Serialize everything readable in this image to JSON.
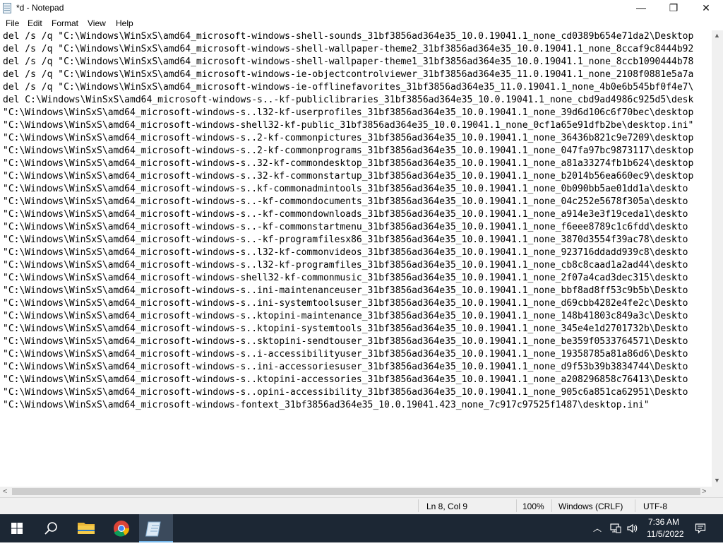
{
  "window": {
    "title": "*d - Notepad"
  },
  "controls": {
    "minimize": "—",
    "maximize": "❐",
    "close": "✕"
  },
  "menu": [
    "File",
    "Edit",
    "Format",
    "View",
    "Help"
  ],
  "editor": {
    "lines": [
      "del /s /q \"C:\\Windows\\WinSxS\\amd64_microsoft-windows-shell-sounds_31bf3856ad364e35_10.0.19041.1_none_cd0389b654e71da2\\Desktop",
      "del /s /q \"C:\\Windows\\WinSxS\\amd64_microsoft-windows-shell-wallpaper-theme2_31bf3856ad364e35_10.0.19041.1_none_8ccaf9c8444b92",
      "del /s /q \"C:\\Windows\\WinSxS\\amd64_microsoft-windows-shell-wallpaper-theme1_31bf3856ad364e35_10.0.19041.1_none_8ccb1090444b78",
      "del /s /q \"C:\\Windows\\WinSxS\\amd64_microsoft-windows-ie-objectcontrolviewer_31bf3856ad364e35_11.0.19041.1_none_2108f0881e5a7a",
      "del /s /q \"C:\\Windows\\WinSxS\\amd64_microsoft-windows-ie-offlinefavorites_31bf3856ad364e35_11.0.19041.1_none_4b0e6b545bf0f4e7\\",
      "del C:\\Windows\\WinSxS\\amd64_microsoft-windows-s..-kf-publiclibraries_31bf3856ad364e35_10.0.19041.1_none_cbd9ad4986c925d5\\desk",
      "\"C:\\Windows\\WinSxS\\amd64_microsoft-windows-s..l32-kf-userprofiles_31bf3856ad364e35_10.0.19041.1_none_39d6d106c6f70bec\\desktop",
      "\"C:\\Windows\\WinSxS\\amd64_microsoft-windows-shell32-kf-public_31bf3856ad364e35_10.0.19041.1_none_0cf1a65e91dfb2be\\desktop.ini\"",
      "\"C:\\Windows\\WinSxS\\amd64_microsoft-windows-s..2-kf-commonpictures_31bf3856ad364e35_10.0.19041.1_none_36436b821c9e7209\\desktop",
      "\"C:\\Windows\\WinSxS\\amd64_microsoft-windows-s..2-kf-commonprograms_31bf3856ad364e35_10.0.19041.1_none_047fa97bc9873117\\desktop",
      "\"C:\\Windows\\WinSxS\\amd64_microsoft-windows-s..32-kf-commondesktop_31bf3856ad364e35_10.0.19041.1_none_a81a33274fb1b624\\desktop",
      "\"C:\\Windows\\WinSxS\\amd64_microsoft-windows-s..32-kf-commonstartup_31bf3856ad364e35_10.0.19041.1_none_b2014b56ea660ec9\\desktop",
      "\"C:\\Windows\\WinSxS\\amd64_microsoft-windows-s..kf-commonadmintools_31bf3856ad364e35_10.0.19041.1_none_0b090bb5ae01dd1a\\deskto",
      "\"C:\\Windows\\WinSxS\\amd64_microsoft-windows-s..-kf-commondocuments_31bf3856ad364e35_10.0.19041.1_none_04c252e5678f305a\\deskto",
      "\"C:\\Windows\\WinSxS\\amd64_microsoft-windows-s..-kf-commondownloads_31bf3856ad364e35_10.0.19041.1_none_a914e3e3f19ceda1\\deskto",
      "\"C:\\Windows\\WinSxS\\amd64_microsoft-windows-s..-kf-commonstartmenu_31bf3856ad364e35_10.0.19041.1_none_f6eee8789c1c6fdd\\deskto",
      "\"C:\\Windows\\WinSxS\\amd64_microsoft-windows-s..-kf-programfilesx86_31bf3856ad364e35_10.0.19041.1_none_3870d3554f39ac78\\deskto",
      "\"C:\\Windows\\WinSxS\\amd64_microsoft-windows-s..l32-kf-commonvideos_31bf3856ad364e35_10.0.19041.1_none_923716ddadd939c8\\deskto",
      "\"C:\\Windows\\WinSxS\\amd64_microsoft-windows-s..l32-kf-programfiles_31bf3856ad364e35_10.0.19041.1_none_cb8c8caad1a2ad44\\deskto",
      "\"C:\\Windows\\WinSxS\\amd64_microsoft-windows-shell32-kf-commonmusic_31bf3856ad364e35_10.0.19041.1_none_2f07a4cad3dec315\\deskto",
      "\"C:\\Windows\\WinSxS\\amd64_microsoft-windows-s..ini-maintenanceuser_31bf3856ad364e35_10.0.19041.1_none_bbf8ad8ff53c9b5b\\Deskto",
      "\"C:\\Windows\\WinSxS\\amd64_microsoft-windows-s..ini-systemtoolsuser_31bf3856ad364e35_10.0.19041.1_none_d69cbb4282e4fe2c\\Deskto",
      "\"C:\\Windows\\WinSxS\\amd64_microsoft-windows-s..ktopini-maintenance_31bf3856ad364e35_10.0.19041.1_none_148b41803c849a3c\\Deskto",
      "\"C:\\Windows\\WinSxS\\amd64_microsoft-windows-s..ktopini-systemtools_31bf3856ad364e35_10.0.19041.1_none_345e4e1d2701732b\\Deskto",
      "\"C:\\Windows\\WinSxS\\amd64_microsoft-windows-s..sktopini-sendtouser_31bf3856ad364e35_10.0.19041.1_none_be359f0533764571\\Deskto",
      "\"C:\\Windows\\WinSxS\\amd64_microsoft-windows-s..i-accessibilityuser_31bf3856ad364e35_10.0.19041.1_none_19358785a81a86d6\\Deskto",
      "\"C:\\Windows\\WinSxS\\amd64_microsoft-windows-s..ini-accessoriesuser_31bf3856ad364e35_10.0.19041.1_none_d9f53b39b3834744\\Deskto",
      "\"C:\\Windows\\WinSxS\\amd64_microsoft-windows-s..ktopini-accessories_31bf3856ad364e35_10.0.19041.1_none_a208296858c76413\\Deskto",
      "\"C:\\Windows\\WinSxS\\amd64_microsoft-windows-s..opini-accessibility_31bf3856ad364e35_10.0.19041.1_none_905c6a851ca62951\\Deskto",
      "\"C:\\Windows\\WinSxS\\amd64_microsoft-windows-fontext_31bf3856ad364e35_10.0.19041.423_none_7c917c97525f1487\\desktop.ini\""
    ]
  },
  "status": {
    "position": "Ln 8, Col 9",
    "zoom": "100%",
    "line_ending": "Windows (CRLF)",
    "encoding": "UTF-8"
  },
  "taskbar": {
    "time": "7:36 AM",
    "date": "11/5/2022",
    "apps": [
      "start-icon",
      "search-icon",
      "file-explorer-icon",
      "chrome-icon",
      "notepad-icon"
    ]
  }
}
